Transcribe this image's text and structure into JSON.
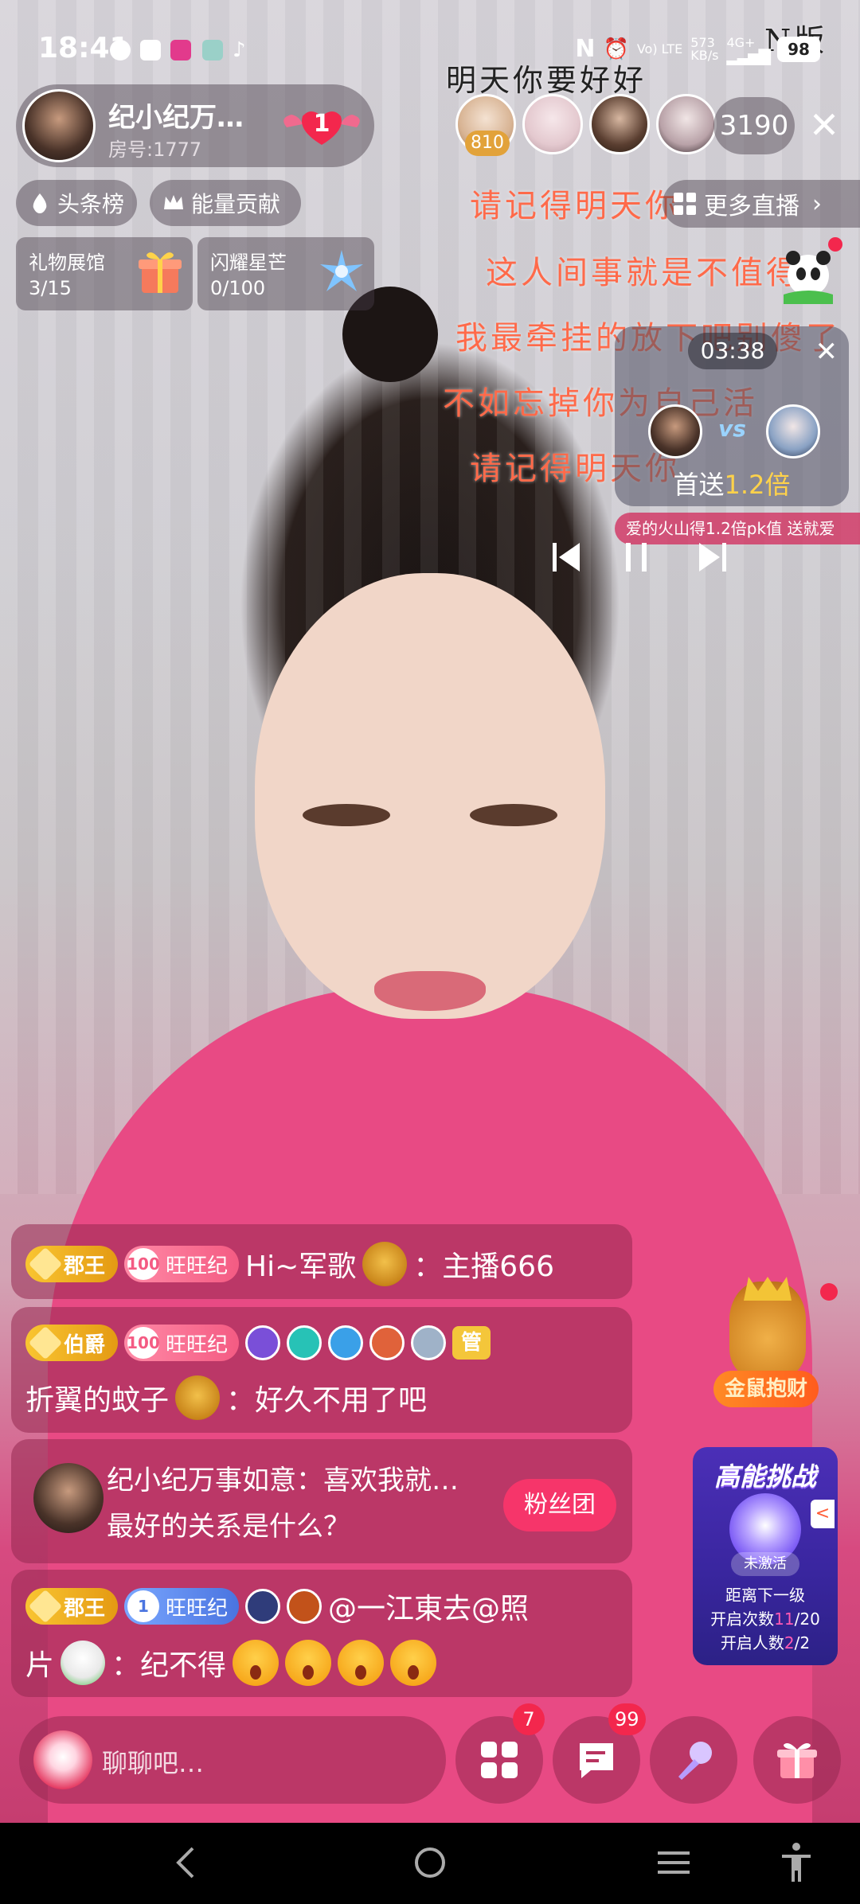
{
  "status_bar": {
    "time": "18:41",
    "network_speed": "573",
    "network_unit": "KB/s",
    "network_type": "4G+",
    "volte": "Vo) LTE",
    "battery": "98"
  },
  "host": {
    "name": "纪小纪万…",
    "room_no": "房号:1777",
    "follow_count": "1"
  },
  "viewers": {
    "badge_value": "810",
    "online_count": "3190"
  },
  "chips": {
    "headline": "头条榜",
    "energy": "能量贡献"
  },
  "tasks": [
    {
      "title": "礼物展馆",
      "value": "3/15"
    },
    {
      "title": "闪耀星芒",
      "value": "0/100"
    }
  ],
  "more_live": "更多直播",
  "lyrics": [
    "明天你要好好",
    "请记得明天你",
    "这人间事就是不值得",
    "我最牵挂的放下吧别傻了",
    "不如忘掉你为自己活",
    "请记得明天你",
    "N版"
  ],
  "pk": {
    "timer": "03:38",
    "vs": "vs",
    "bonus_prefix": "首送",
    "bonus_value": "1.2倍",
    "ticker": "爱的火山得1.2倍pk值   送就爱"
  },
  "chat": [
    {
      "rank": "郡王",
      "fan_level": "100",
      "fan_name": "旺旺纪",
      "user": "Hi~军歌",
      "text": "：主播666"
    },
    {
      "rank": "伯爵",
      "fan_level": "100",
      "fan_name": "旺旺纪",
      "manager": "管",
      "user": "折翼的蚊子",
      "text": "：好久不用了吧"
    },
    {
      "prompt_line1": "纪小纪万事如意：喜欢我就…",
      "prompt_line2": "最好的关系是什么？",
      "fans_button": "粉丝团"
    },
    {
      "rank": "郡王",
      "fan_level": "1",
      "fan_name": "旺旺纪",
      "user": "@一江東去@照",
      "user_cont": "片",
      "text": "：纪不得"
    }
  ],
  "widgets": {
    "mouse_label": "金鼠抱财",
    "challenge_title": "高能挑战",
    "challenge_status": "未激活",
    "challenge_line1": "距离下一级",
    "challenge_opens_label": "开启次数",
    "challenge_opens_value": "11",
    "challenge_opens_total": "/20",
    "challenge_people_label": "开启人数",
    "challenge_people_value": "2",
    "challenge_people_total": "/2",
    "side_tab": "<"
  },
  "bottom_bar": {
    "placeholder": "聊聊吧…",
    "apps_badge": "7",
    "message_badge": "99"
  },
  "colors": {
    "accent_pink": "#f6356a",
    "notif_red": "#f3274d",
    "gold": "#f4c63a"
  }
}
